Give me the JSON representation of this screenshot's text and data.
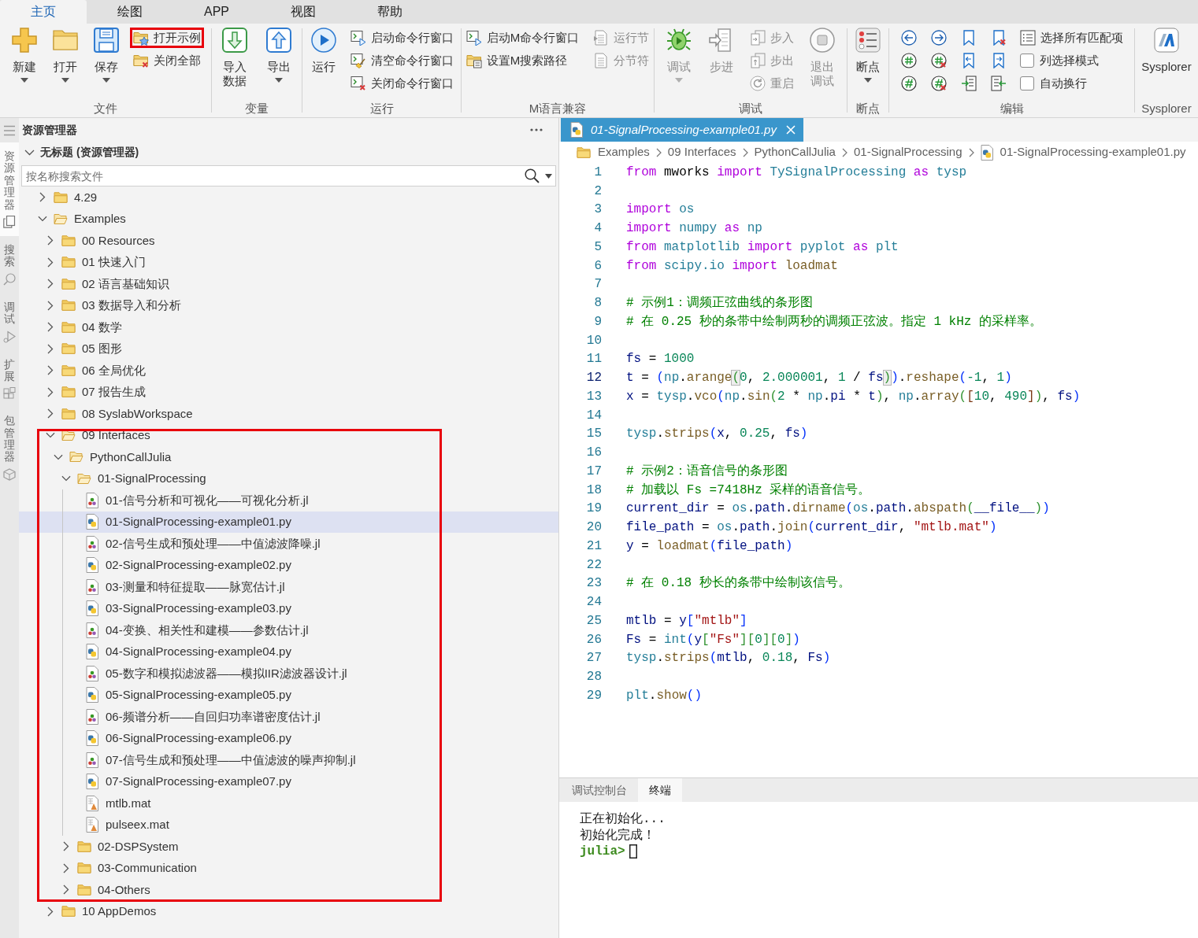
{
  "ribbon": {
    "tabs": [
      {
        "label": "主页",
        "selected": true
      },
      {
        "label": "绘图",
        "selected": false
      },
      {
        "label": "APP",
        "selected": false
      },
      {
        "label": "视图",
        "selected": false
      },
      {
        "label": "帮助",
        "selected": false
      }
    ],
    "groups": [
      {
        "label": "文件",
        "columns": [
          [
            {
              "kind": "large",
              "label": "新建",
              "dropdown": true,
              "disabled": false,
              "highlighted": false
            }
          ],
          [
            {
              "kind": "large",
              "label": "打开",
              "dropdown": true,
              "disabled": false,
              "highlighted": false
            }
          ],
          [
            {
              "kind": "large",
              "label": "保存",
              "dropdown": true,
              "disabled": false,
              "highlighted": false
            }
          ],
          [
            {
              "kind": "small",
              "label": "打开示例",
              "disabled": false,
              "highlighted": true
            },
            {
              "kind": "small",
              "label": "关闭全部",
              "disabled": false,
              "highlighted": false
            }
          ]
        ]
      },
      {
        "label": "变量",
        "columns": [
          [
            {
              "kind": "large",
              "label": "导入数据",
              "dropdown": false,
              "disabled": false,
              "highlighted": false
            }
          ],
          [
            {
              "kind": "large",
              "label": "导出",
              "dropdown": true,
              "disabled": false,
              "highlighted": false
            }
          ]
        ]
      },
      {
        "label": "运行",
        "columns": [
          [
            {
              "kind": "large",
              "label": "运行",
              "dropdown": false,
              "disabled": false,
              "highlighted": false
            }
          ],
          [
            {
              "kind": "small",
              "label": "启动命令行窗口",
              "disabled": false,
              "highlighted": false
            },
            {
              "kind": "small",
              "label": "清空命令行窗口",
              "disabled": false,
              "highlighted": false
            },
            {
              "kind": "small",
              "label": "关闭命令行窗口",
              "disabled": false,
              "highlighted": false
            }
          ]
        ]
      },
      {
        "label": "M语言兼容",
        "columns": [
          [
            {
              "kind": "small",
              "label": "启动M命令行窗口",
              "disabled": false,
              "highlighted": false
            },
            {
              "kind": "small",
              "label": "设置M搜索路径",
              "disabled": false,
              "highlighted": false
            }
          ],
          [
            {
              "kind": "small",
              "label": "运行节",
              "disabled": true,
              "highlighted": false
            },
            {
              "kind": "small",
              "label": "分节符",
              "disabled": true,
              "highlighted": false
            }
          ]
        ]
      },
      {
        "label": "调试",
        "columns": [
          [
            {
              "kind": "large",
              "label": "调试",
              "dropdown": true,
              "disabled": true,
              "highlighted": false
            }
          ],
          [
            {
              "kind": "large",
              "label": "步进",
              "dropdown": false,
              "disabled": true,
              "highlighted": false
            }
          ],
          [
            {
              "kind": "small",
              "label": "步入",
              "disabled": true,
              "highlighted": false
            },
            {
              "kind": "small",
              "label": "步出",
              "disabled": true,
              "highlighted": false
            },
            {
              "kind": "small",
              "label": "重启",
              "disabled": true,
              "highlighted": false
            }
          ],
          [
            {
              "kind": "large",
              "label": "退出调试",
              "dropdown": false,
              "disabled": true,
              "highlighted": false
            }
          ]
        ]
      },
      {
        "label": "断点",
        "columns": [
          [
            {
              "kind": "large",
              "label": "断点",
              "dropdown": true,
              "disabled": false,
              "highlighted": false
            }
          ]
        ]
      },
      {
        "label": "编辑",
        "columns": [
          [
            {
              "kind": "icon",
              "disabled": false,
              "highlighted": false
            },
            {
              "kind": "icon",
              "disabled": false,
              "highlighted": false
            },
            {
              "kind": "icon",
              "disabled": false,
              "highlighted": false
            }
          ],
          [
            {
              "kind": "icon",
              "disabled": false,
              "highlighted": false
            },
            {
              "kind": "icon",
              "disabled": false,
              "highlighted": false
            },
            {
              "kind": "icon",
              "disabled": false,
              "highlighted": false
            }
          ],
          [
            {
              "kind": "icon",
              "disabled": false,
              "highlighted": false
            },
            {
              "kind": "icon",
              "disabled": false,
              "highlighted": false
            },
            {
              "kind": "icon",
              "disabled": false,
              "highlighted": false
            }
          ],
          [
            {
              "kind": "icon",
              "disabled": false,
              "highlighted": false
            },
            {
              "kind": "icon",
              "disabled": false,
              "highlighted": false
            },
            {
              "kind": "icon",
              "disabled": false,
              "highlighted": false
            }
          ],
          [
            {
              "kind": "small",
              "label": "选择所有匹配项",
              "disabled": false,
              "highlighted": false
            },
            {
              "kind": "check",
              "label": "列选择模式",
              "checked": false,
              "disabled": false,
              "highlighted": false
            },
            {
              "kind": "check",
              "label": "自动换行",
              "checked": false,
              "disabled": false,
              "highlighted": false
            }
          ]
        ]
      },
      {
        "label": "Sysplorer",
        "columns": [
          [
            {
              "kind": "large",
              "label": "Sysplorer",
              "dropdown": false,
              "disabled": false,
              "highlighted": false
            }
          ]
        ]
      }
    ]
  },
  "activity_bar": {
    "items": [
      {
        "label": "资源管理器",
        "selected": true
      },
      {
        "label": "搜索",
        "selected": false
      },
      {
        "label": "调试",
        "selected": false
      },
      {
        "label": "扩展",
        "selected": false
      },
      {
        "label": "包管理器",
        "selected": false
      }
    ]
  },
  "explorer": {
    "title": "资源管理器",
    "section": {
      "title": "无标题 (资源管理器)",
      "expanded": true
    },
    "search": {
      "placeholder": "按名称搜索文件"
    },
    "tree": [
      {
        "kind": "folder",
        "label": "4.29",
        "expanded": false,
        "selected": false,
        "highlighted": false
      },
      {
        "kind": "folder",
        "label": "Examples",
        "expanded": true,
        "selected": false,
        "highlighted": false,
        "children": [
          {
            "kind": "folder",
            "label": "00 Resources",
            "expanded": false,
            "selected": false,
            "highlighted": false
          },
          {
            "kind": "folder",
            "label": "01 快速入门",
            "expanded": false,
            "selected": false,
            "highlighted": false
          },
          {
            "kind": "folder",
            "label": "02 语言基础知识",
            "expanded": false,
            "selected": false,
            "highlighted": false
          },
          {
            "kind": "folder",
            "label": "03 数据导入和分析",
            "expanded": false,
            "selected": false,
            "highlighted": false
          },
          {
            "kind": "folder",
            "label": "04 数学",
            "expanded": false,
            "selected": false,
            "highlighted": false
          },
          {
            "kind": "folder",
            "label": "05 图形",
            "expanded": false,
            "selected": false,
            "highlighted": false
          },
          {
            "kind": "folder",
            "label": "06 全局优化",
            "expanded": false,
            "selected": false,
            "highlighted": false
          },
          {
            "kind": "folder",
            "label": "07 报告生成",
            "expanded": false,
            "selected": false,
            "highlighted": false
          },
          {
            "kind": "folder",
            "label": "08 SyslabWorkspace",
            "expanded": false,
            "selected": false,
            "highlighted": false
          },
          {
            "kind": "folder",
            "label": "09 Interfaces",
            "expanded": true,
            "selected": false,
            "highlighted": true,
            "children": [
              {
                "kind": "folder",
                "label": "PythonCallJulia",
                "expanded": true,
                "selected": false,
                "highlighted": false,
                "children": [
                  {
                    "kind": "folder",
                    "label": "01-SignalProcessing",
                    "expanded": true,
                    "selected": false,
                    "highlighted": false,
                    "children": [
                      {
                        "kind": "julia",
                        "label": "01-信号分析和可视化——可视化分析.jl",
                        "selected": false,
                        "highlighted": false
                      },
                      {
                        "kind": "python",
                        "label": "01-SignalProcessing-example01.py",
                        "selected": true,
                        "highlighted": false
                      },
                      {
                        "kind": "julia",
                        "label": "02-信号生成和预处理——中值滤波降噪.jl",
                        "selected": false,
                        "highlighted": false
                      },
                      {
                        "kind": "python",
                        "label": "02-SignalProcessing-example02.py",
                        "selected": false,
                        "highlighted": false
                      },
                      {
                        "kind": "julia",
                        "label": "03-测量和特征提取——脉宽估计.jl",
                        "selected": false,
                        "highlighted": false
                      },
                      {
                        "kind": "python",
                        "label": "03-SignalProcessing-example03.py",
                        "selected": false,
                        "highlighted": false
                      },
                      {
                        "kind": "julia",
                        "label": "04-变换、相关性和建模——参数估计.jl",
                        "selected": false,
                        "highlighted": false
                      },
                      {
                        "kind": "python",
                        "label": "04-SignalProcessing-example04.py",
                        "selected": false,
                        "highlighted": false
                      },
                      {
                        "kind": "julia",
                        "label": "05-数字和模拟滤波器——模拟IIR滤波器设计.jl",
                        "selected": false,
                        "highlighted": false
                      },
                      {
                        "kind": "python",
                        "label": "05-SignalProcessing-example05.py",
                        "selected": false,
                        "highlighted": false
                      },
                      {
                        "kind": "julia",
                        "label": "06-频谱分析——自回归功率谱密度估计.jl",
                        "selected": false,
                        "highlighted": false
                      },
                      {
                        "kind": "python",
                        "label": "06-SignalProcessing-example06.py",
                        "selected": false,
                        "highlighted": false
                      },
                      {
                        "kind": "julia",
                        "label": "07-信号生成和预处理——中值滤波的噪声抑制.jl",
                        "selected": false,
                        "highlighted": false
                      },
                      {
                        "kind": "python",
                        "label": "07-SignalProcessing-example07.py",
                        "selected": false,
                        "highlighted": false
                      },
                      {
                        "kind": "mat",
                        "label": "mtlb.mat",
                        "selected": false,
                        "highlighted": false
                      },
                      {
                        "kind": "mat",
                        "label": "pulseex.mat",
                        "selected": false,
                        "highlighted": false
                      }
                    ]
                  },
                  {
                    "kind": "folder",
                    "label": "02-DSPSystem",
                    "expanded": false,
                    "selected": false,
                    "highlighted": false
                  },
                  {
                    "kind": "folder",
                    "label": "03-Communication",
                    "expanded": false,
                    "selected": false,
                    "highlighted": false
                  },
                  {
                    "kind": "folder",
                    "label": "04-Others",
                    "expanded": false,
                    "selected": false,
                    "highlighted": false
                  }
                ]
              }
            ]
          },
          {
            "kind": "folder",
            "label": "10 AppDemos",
            "expanded": false,
            "selected": false,
            "highlighted": false
          }
        ]
      }
    ]
  },
  "editor": {
    "tabs": [
      {
        "kind": "python",
        "label": "01-SignalProcessing-example01.py",
        "selected": true
      }
    ],
    "breadcrumbs": [
      {
        "kind": "folder",
        "label": "Examples"
      },
      {
        "kind": "plain",
        "label": "09 Interfaces"
      },
      {
        "kind": "plain",
        "label": "PythonCallJulia"
      },
      {
        "kind": "plain",
        "label": "01-SignalProcessing"
      },
      {
        "kind": "python",
        "label": "01-SignalProcessing-example01.py"
      }
    ],
    "lines": [
      {
        "number": "1",
        "current": false,
        "tokens": [
          {
            "kind": "keyword",
            "text": "from"
          },
          {
            "kind": "plain",
            "text": " mworks "
          },
          {
            "kind": "keyword",
            "text": "import"
          },
          {
            "kind": "module",
            "text": " TySignalProcessing"
          },
          {
            "kind": "keyword",
            "text": " as"
          },
          {
            "kind": "module",
            "text": " tysp"
          }
        ]
      },
      {
        "number": "2",
        "current": false
      },
      {
        "number": "3",
        "current": false,
        "tokens": [
          {
            "kind": "keyword",
            "text": "import"
          },
          {
            "kind": "module",
            "text": " os"
          }
        ]
      },
      {
        "number": "4",
        "current": false,
        "tokens": [
          {
            "kind": "keyword",
            "text": "import"
          },
          {
            "kind": "module",
            "text": " numpy"
          },
          {
            "kind": "keyword",
            "text": " as"
          },
          {
            "kind": "module",
            "text": " np"
          }
        ]
      },
      {
        "number": "5",
        "current": false,
        "tokens": [
          {
            "kind": "keyword",
            "text": "from"
          },
          {
            "kind": "module",
            "text": " matplotlib"
          },
          {
            "kind": "keyword",
            "text": " import"
          },
          {
            "kind": "module",
            "text": " pyplot"
          },
          {
            "kind": "keyword",
            "text": " as"
          },
          {
            "kind": "module",
            "text": " plt"
          }
        ]
      },
      {
        "number": "6",
        "current": false,
        "tokens": [
          {
            "kind": "keyword",
            "text": "from"
          },
          {
            "kind": "module",
            "text": " scipy.io"
          },
          {
            "kind": "keyword",
            "text": " import"
          },
          {
            "kind": "function",
            "text": " loadmat"
          }
        ]
      },
      {
        "number": "7",
        "current": false
      },
      {
        "number": "8",
        "current": false,
        "tokens": [
          {
            "kind": "comment",
            "text": "# 示例1：调频正弦曲线的条形图"
          }
        ]
      },
      {
        "number": "9",
        "current": false,
        "tokens": [
          {
            "kind": "comment",
            "text": "# 在 0.25 秒的条带中绘制两秒的调频正弦波。指定 1 kHz 的采样率。"
          }
        ]
      },
      {
        "number": "10",
        "current": false
      },
      {
        "number": "11",
        "current": false,
        "tokens": [
          {
            "kind": "variable",
            "text": "fs"
          },
          {
            "kind": "plain",
            "text": " = "
          },
          {
            "kind": "number",
            "text": "1000"
          }
        ]
      },
      {
        "number": "12",
        "current": true,
        "tokens": [
          {
            "kind": "variable",
            "text": "t"
          },
          {
            "kind": "plain",
            "text": " = "
          },
          {
            "kind": "bracket",
            "text": "("
          },
          {
            "kind": "module",
            "text": "np"
          },
          {
            "kind": "plain",
            "text": "."
          },
          {
            "kind": "function",
            "text": "arange"
          },
          {
            "kind": "match",
            "text": "("
          },
          {
            "kind": "number",
            "text": "0"
          },
          {
            "kind": "plain",
            "text": ", "
          },
          {
            "kind": "number",
            "text": "2.000001"
          },
          {
            "kind": "plain",
            "text": ", "
          },
          {
            "kind": "number",
            "text": "1"
          },
          {
            "kind": "plain",
            "text": " / "
          },
          {
            "kind": "variable",
            "text": "fs"
          },
          {
            "kind": "match",
            "text": ")"
          },
          {
            "kind": "bracket",
            "text": ")"
          },
          {
            "kind": "plain",
            "text": "."
          },
          {
            "kind": "function",
            "text": "reshape"
          },
          {
            "kind": "bracket",
            "text": "("
          },
          {
            "kind": "number",
            "text": "-1"
          },
          {
            "kind": "plain",
            "text": ", "
          },
          {
            "kind": "number",
            "text": "1"
          },
          {
            "kind": "bracket",
            "text": ")"
          }
        ]
      },
      {
        "number": "13",
        "current": false,
        "tokens": [
          {
            "kind": "variable",
            "text": "x"
          },
          {
            "kind": "plain",
            "text": " = "
          },
          {
            "kind": "module",
            "text": "tysp"
          },
          {
            "kind": "plain",
            "text": "."
          },
          {
            "kind": "function",
            "text": "vco"
          },
          {
            "kind": "bracket",
            "text": "("
          },
          {
            "kind": "module",
            "text": "np"
          },
          {
            "kind": "plain",
            "text": "."
          },
          {
            "kind": "function",
            "text": "sin"
          },
          {
            "kind": "bracket2",
            "text": "("
          },
          {
            "kind": "number",
            "text": "2"
          },
          {
            "kind": "plain",
            "text": " * "
          },
          {
            "kind": "module",
            "text": "np"
          },
          {
            "kind": "plain",
            "text": "."
          },
          {
            "kind": "variable",
            "text": "pi"
          },
          {
            "kind": "plain",
            "text": " * "
          },
          {
            "kind": "variable",
            "text": "t"
          },
          {
            "kind": "bracket2",
            "text": ")"
          },
          {
            "kind": "plain",
            "text": ", "
          },
          {
            "kind": "module",
            "text": "np"
          },
          {
            "kind": "plain",
            "text": "."
          },
          {
            "kind": "function",
            "text": "array"
          },
          {
            "kind": "bracket2",
            "text": "("
          },
          {
            "kind": "bracket3",
            "text": "["
          },
          {
            "kind": "number",
            "text": "10"
          },
          {
            "kind": "plain",
            "text": ", "
          },
          {
            "kind": "number",
            "text": "490"
          },
          {
            "kind": "bracket3",
            "text": "]"
          },
          {
            "kind": "bracket2",
            "text": ")"
          },
          {
            "kind": "plain",
            "text": ", "
          },
          {
            "kind": "variable",
            "text": "fs"
          },
          {
            "kind": "bracket",
            "text": ")"
          }
        ]
      },
      {
        "number": "14",
        "current": false
      },
      {
        "number": "15",
        "current": false,
        "tokens": [
          {
            "kind": "module",
            "text": "tysp"
          },
          {
            "kind": "plain",
            "text": "."
          },
          {
            "kind": "function",
            "text": "strips"
          },
          {
            "kind": "bracket",
            "text": "("
          },
          {
            "kind": "variable",
            "text": "x"
          },
          {
            "kind": "plain",
            "text": ", "
          },
          {
            "kind": "number",
            "text": "0.25"
          },
          {
            "kind": "plain",
            "text": ", "
          },
          {
            "kind": "variable",
            "text": "fs"
          },
          {
            "kind": "bracket",
            "text": ")"
          }
        ]
      },
      {
        "number": "16",
        "current": false
      },
      {
        "number": "17",
        "current": false,
        "tokens": [
          {
            "kind": "comment",
            "text": "# 示例2：语音信号的条形图"
          }
        ]
      },
      {
        "number": "18",
        "current": false,
        "tokens": [
          {
            "kind": "comment",
            "text": "# 加载以 Fs =7418Hz 采样的语音信号。"
          }
        ]
      },
      {
        "number": "19",
        "current": false,
        "tokens": [
          {
            "kind": "variable",
            "text": "current_dir"
          },
          {
            "kind": "plain",
            "text": " = "
          },
          {
            "kind": "module",
            "text": "os"
          },
          {
            "kind": "plain",
            "text": "."
          },
          {
            "kind": "variable",
            "text": "path"
          },
          {
            "kind": "plain",
            "text": "."
          },
          {
            "kind": "function",
            "text": "dirname"
          },
          {
            "kind": "bracket",
            "text": "("
          },
          {
            "kind": "module",
            "text": "os"
          },
          {
            "kind": "plain",
            "text": "."
          },
          {
            "kind": "variable",
            "text": "path"
          },
          {
            "kind": "plain",
            "text": "."
          },
          {
            "kind": "function",
            "text": "abspath"
          },
          {
            "kind": "bracket2",
            "text": "("
          },
          {
            "kind": "variable",
            "text": "__file__"
          },
          {
            "kind": "bracket2",
            "text": ")"
          },
          {
            "kind": "bracket",
            "text": ")"
          }
        ]
      },
      {
        "number": "20",
        "current": false,
        "tokens": [
          {
            "kind": "variable",
            "text": "file_path"
          },
          {
            "kind": "plain",
            "text": " = "
          },
          {
            "kind": "module",
            "text": "os"
          },
          {
            "kind": "plain",
            "text": "."
          },
          {
            "kind": "variable",
            "text": "path"
          },
          {
            "kind": "plain",
            "text": "."
          },
          {
            "kind": "function",
            "text": "join"
          },
          {
            "kind": "bracket",
            "text": "("
          },
          {
            "kind": "variable",
            "text": "current_dir"
          },
          {
            "kind": "plain",
            "text": ", "
          },
          {
            "kind": "string",
            "text": "\"mtlb.mat\""
          },
          {
            "kind": "bracket",
            "text": ")"
          }
        ]
      },
      {
        "number": "21",
        "current": false,
        "tokens": [
          {
            "kind": "variable",
            "text": "y"
          },
          {
            "kind": "plain",
            "text": " = "
          },
          {
            "kind": "function",
            "text": "loadmat"
          },
          {
            "kind": "bracket",
            "text": "("
          },
          {
            "kind": "variable",
            "text": "file_path"
          },
          {
            "kind": "bracket",
            "text": ")"
          }
        ]
      },
      {
        "number": "22",
        "current": false
      },
      {
        "number": "23",
        "current": false,
        "tokens": [
          {
            "kind": "comment",
            "text": "# 在 0.18 秒长的条带中绘制该信号。"
          }
        ]
      },
      {
        "number": "24",
        "current": false
      },
      {
        "number": "25",
        "current": false,
        "tokens": [
          {
            "kind": "variable",
            "text": "mtlb"
          },
          {
            "kind": "plain",
            "text": " = "
          },
          {
            "kind": "variable",
            "text": "y"
          },
          {
            "kind": "bracket",
            "text": "["
          },
          {
            "kind": "string",
            "text": "\"mtlb\""
          },
          {
            "kind": "bracket",
            "text": "]"
          }
        ]
      },
      {
        "number": "26",
        "current": false,
        "tokens": [
          {
            "kind": "variable",
            "text": "Fs"
          },
          {
            "kind": "plain",
            "text": " = "
          },
          {
            "kind": "module",
            "text": "int"
          },
          {
            "kind": "bracket",
            "text": "("
          },
          {
            "kind": "variable",
            "text": "y"
          },
          {
            "kind": "bracket2",
            "text": "["
          },
          {
            "kind": "string",
            "text": "\"Fs\""
          },
          {
            "kind": "bracket2",
            "text": "]"
          },
          {
            "kind": "bracket2",
            "text": "["
          },
          {
            "kind": "number",
            "text": "0"
          },
          {
            "kind": "bracket2",
            "text": "]"
          },
          {
            "kind": "bracket2",
            "text": "["
          },
          {
            "kind": "number",
            "text": "0"
          },
          {
            "kind": "bracket2",
            "text": "]"
          },
          {
            "kind": "bracket",
            "text": ")"
          }
        ]
      },
      {
        "number": "27",
        "current": false,
        "tokens": [
          {
            "kind": "module",
            "text": "tysp"
          },
          {
            "kind": "plain",
            "text": "."
          },
          {
            "kind": "function",
            "text": "strips"
          },
          {
            "kind": "bracket",
            "text": "("
          },
          {
            "kind": "variable",
            "text": "mtlb"
          },
          {
            "kind": "plain",
            "text": ", "
          },
          {
            "kind": "number",
            "text": "0.18"
          },
          {
            "kind": "plain",
            "text": ", "
          },
          {
            "kind": "variable",
            "text": "Fs"
          },
          {
            "kind": "bracket",
            "text": ")"
          }
        ]
      },
      {
        "number": "28",
        "current": false
      },
      {
        "number": "29",
        "current": false,
        "tokens": [
          {
            "kind": "module",
            "text": "plt"
          },
          {
            "kind": "plain",
            "text": "."
          },
          {
            "kind": "function",
            "text": "show"
          },
          {
            "kind": "bracket",
            "text": "("
          },
          {
            "kind": "bracket",
            "text": ")"
          }
        ]
      }
    ]
  },
  "panel": {
    "tabs": [
      {
        "label": "调试控制台",
        "selected": false
      },
      {
        "label": "终端",
        "selected": true
      }
    ],
    "lines": [
      {
        "kind": "output",
        "text": "正在初始化..."
      },
      {
        "kind": "output",
        "text": "初始化完成！"
      },
      {
        "kind": "prompt",
        "text": "julia>"
      }
    ]
  }
}
